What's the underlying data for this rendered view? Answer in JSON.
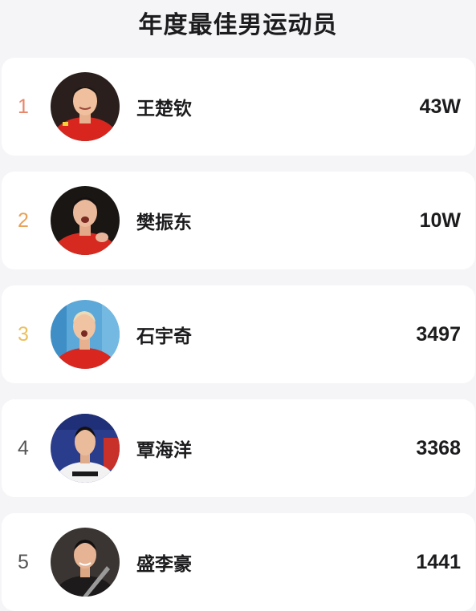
{
  "header": {
    "title": "年度最佳男运动员"
  },
  "colors": {
    "rank_1": "#e8866a",
    "rank_2": "#e9a25c",
    "rank_3": "#ecc05c",
    "rank_default": "#555555"
  },
  "ranking": [
    {
      "rank": "1",
      "name": "王楚钦",
      "votes": "43W",
      "avatar_icon": "athlete-avatar"
    },
    {
      "rank": "2",
      "name": "樊振东",
      "votes": "10W",
      "avatar_icon": "athlete-avatar"
    },
    {
      "rank": "3",
      "name": "石宇奇",
      "votes": "3497",
      "avatar_icon": "athlete-avatar"
    },
    {
      "rank": "4",
      "name": "覃海洋",
      "votes": "3368",
      "avatar_icon": "athlete-avatar"
    },
    {
      "rank": "5",
      "name": "盛李豪",
      "votes": "1441",
      "avatar_icon": "athlete-avatar"
    }
  ]
}
